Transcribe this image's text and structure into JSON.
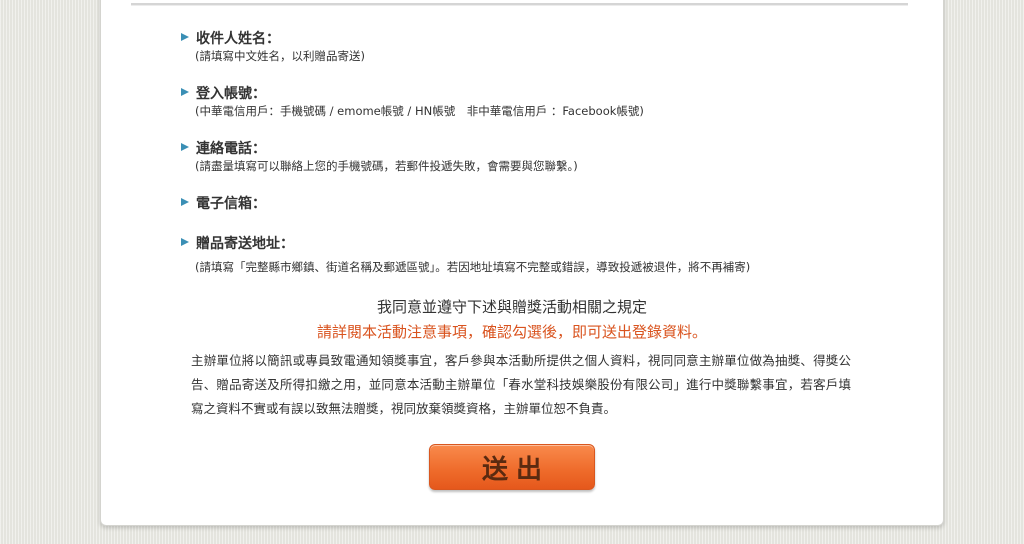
{
  "form": {
    "fields": [
      {
        "label": "收件人姓名：",
        "hint": "(請填寫中文姓名，以利贈品寄送)"
      },
      {
        "label": "登入帳號：",
        "hint": "(中華電信用戶：手機號碼 / emome帳號 / HN帳號　非中華電信用戶 ：Facebook帳號)"
      },
      {
        "label": "連絡電話：",
        "hint": "(請盡量填寫可以聯絡上您的手機號碼，若郵件投遞失敗，會需要與您聯繫。)"
      },
      {
        "label": "電子信箱：",
        "hint": ""
      },
      {
        "label": "贈品寄送地址：",
        "hint": "(請填寫「完整縣市鄉鎮、街道名稱及郵遞區號」。若因地址填寫不完整或錯誤，導致投遞被退件，將不再補寄)"
      }
    ]
  },
  "agreement": {
    "title": "我同意並遵守下述與贈獎活動相關之規定",
    "note": "請詳閱本活動注意事項，確認勾選後，即可送出登錄資料。",
    "body": "主辦單位將以簡訊或專員致電通知領獎事宜，客戶參與本活動所提供之個人資料，視同同意主辦單位做為抽獎、得獎公告、贈品寄送及所得扣繳之用，並同意本活動主辦單位「春水堂科技娛樂股份有限公司」進行中獎聯繫事宜，若客戶填寫之資料不實或有誤以致無法贈獎，視同放棄領獎資格，主辦單位恕不負責。"
  },
  "submit_label": "送出",
  "colors": {
    "accent_orange": "#ee6a2a",
    "note_red": "#d9531e",
    "arrow_blue": "#3a8fb5"
  }
}
